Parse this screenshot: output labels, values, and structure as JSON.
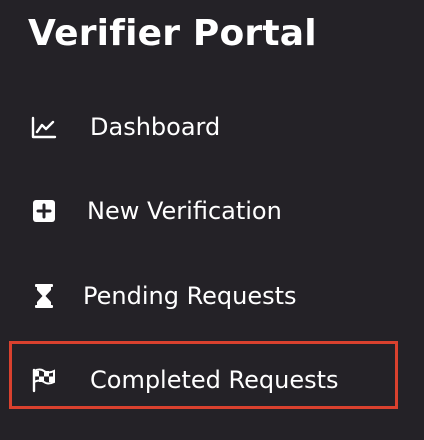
{
  "sidebar": {
    "title": "Verifier Portal",
    "items": [
      {
        "label": "Dashboard",
        "icon": "chart-line-icon"
      },
      {
        "label": "New Verification",
        "icon": "plus-square-icon"
      },
      {
        "label": "Pending Requests",
        "icon": "hourglass-icon"
      },
      {
        "label": "Completed Requests",
        "icon": "checkered-flag-icon",
        "highlighted": true
      }
    ]
  },
  "colors": {
    "background": "#242227",
    "text": "#ffffff",
    "highlight_border": "#d9412e"
  }
}
